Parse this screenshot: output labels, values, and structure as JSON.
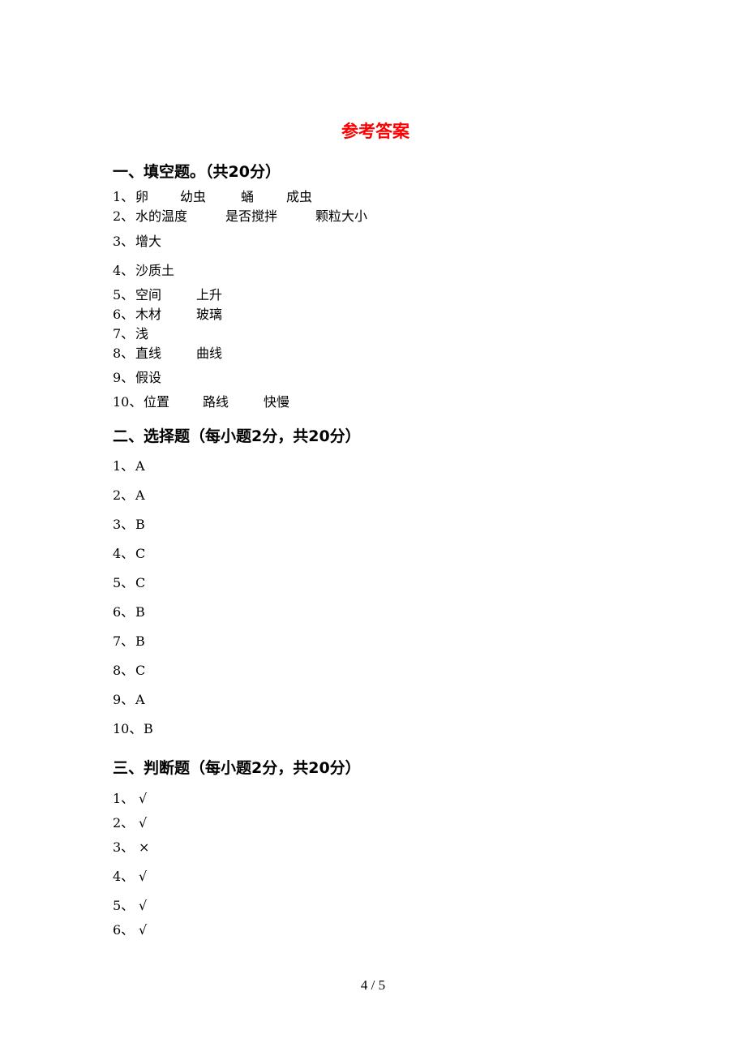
{
  "title": "参考答案",
  "sections": [
    {
      "heading": "一、填空题。（共20分）",
      "items": [
        {
          "num": "1、",
          "parts": [
            "卵",
            "幼虫",
            "蛹",
            "成虫"
          ]
        },
        {
          "num": "2、",
          "parts": [
            "水的温度",
            "是否搅拌",
            "颗粒大小"
          ]
        },
        {
          "num": "3、",
          "parts": [
            "增大"
          ]
        },
        {
          "num": "4、",
          "parts": [
            "沙质土"
          ]
        },
        {
          "num": "5、",
          "parts": [
            "空间",
            "上升"
          ]
        },
        {
          "num": "6、",
          "parts": [
            "木材",
            "玻璃"
          ]
        },
        {
          "num": "7、",
          "parts": [
            "浅"
          ]
        },
        {
          "num": "8、",
          "parts": [
            "直线",
            "曲线"
          ]
        },
        {
          "num": "9、",
          "parts": [
            "假设"
          ]
        },
        {
          "num": "10、",
          "parts": [
            "位置",
            "路线",
            "快慢"
          ]
        }
      ]
    },
    {
      "heading": "二、选择题（每小题2分，共20分）",
      "items": [
        {
          "num": "1、",
          "parts": [
            "A"
          ]
        },
        {
          "num": "2、",
          "parts": [
            "A"
          ]
        },
        {
          "num": "3、",
          "parts": [
            "B"
          ]
        },
        {
          "num": "4、",
          "parts": [
            "C"
          ]
        },
        {
          "num": "5、",
          "parts": [
            "C"
          ]
        },
        {
          "num": "6、",
          "parts": [
            "B"
          ]
        },
        {
          "num": "7、",
          "parts": [
            "B"
          ]
        },
        {
          "num": "8、",
          "parts": [
            "C"
          ]
        },
        {
          "num": "9、",
          "parts": [
            "A"
          ]
        },
        {
          "num": "10、",
          "parts": [
            "B"
          ]
        }
      ]
    },
    {
      "heading": "三、判断题（每小题2分，共20分）",
      "items": [
        {
          "num": "1、",
          "parts": [
            "√"
          ]
        },
        {
          "num": "2、",
          "parts": [
            "√"
          ]
        },
        {
          "num": "3、",
          "parts": [
            "×"
          ]
        },
        {
          "num": "4、",
          "parts": [
            "√"
          ]
        },
        {
          "num": "5、",
          "parts": [
            "√"
          ]
        },
        {
          "num": "6、",
          "parts": [
            "√"
          ]
        }
      ]
    }
  ],
  "footer": {
    "page_indicator": "4 / 5"
  }
}
